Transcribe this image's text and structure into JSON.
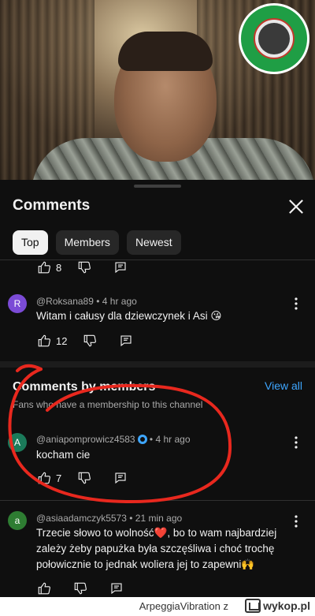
{
  "header": {
    "title": "Comments",
    "close_icon": "close-icon"
  },
  "tabs": [
    {
      "label": "Top",
      "active": true
    },
    {
      "label": "Members",
      "active": false
    },
    {
      "label": "Newest",
      "active": false
    }
  ],
  "top_partial": {
    "like_count": "8"
  },
  "comments_top": [
    {
      "avatar_letter": "R",
      "avatar_color": "#7b4bd6",
      "author": "@Roksana89",
      "time": "4 hr ago",
      "text": "Witam i całusy dla dziewczynek i Asi 😘",
      "like_count": "12"
    }
  ],
  "members_section": {
    "title": "Comments by members",
    "view_all": "View all",
    "subtitle": "Fans who have a membership to this channel"
  },
  "member_comments": [
    {
      "avatar_letter": "A",
      "avatar_color": "#1b7a5a",
      "author": "@aniapomprowicz4583",
      "time": "4 hr ago",
      "text": "kocham cie",
      "like_count": "7"
    }
  ],
  "comments_bottom": [
    {
      "avatar_letter": "a",
      "avatar_color": "#2e7d32",
      "author": "@asiaadamczyk5573",
      "time": "21 min ago",
      "text_lines": [
        "Trzecie słowo to wolność❤️, bo to wam najbardziej",
        "zależy żeby papużka była szczęśliwa i choć trochę",
        "połowicznie to jednak woliera jej to zapewni🙌"
      ],
      "like_count": ""
    }
  ],
  "footer": {
    "user": "ArpeggiaVibration",
    "suffix": "z",
    "site": "wykop.pl"
  },
  "colors": {
    "accent_link": "#3ea6ff",
    "background": "#0f0f0f",
    "annotation_red": "#e8281e"
  }
}
